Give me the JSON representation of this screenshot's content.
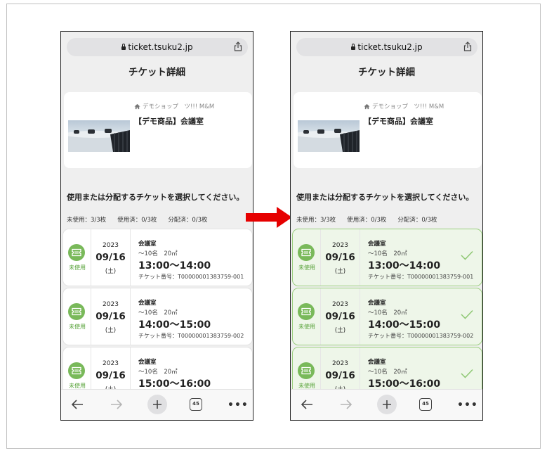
{
  "browser": {
    "url": "ticket.tsuku2.jp",
    "tab_count": "45"
  },
  "page": {
    "title": "チケット詳細",
    "shop": "デモショップ　ツ!!! M&M",
    "product_name": "【デモ商品】会議室",
    "select_heading": "使用または分配するチケットを選択してください。",
    "stats": {
      "unused": "未使用：3/3枚",
      "used": "使用済：0/3枚",
      "distributed": "分配済：0/3枚"
    }
  },
  "tickets": [
    {
      "status": "未使用",
      "year": "2023",
      "md": "09/16",
      "dow": "(土)",
      "room": "会議室",
      "capacity": "～10名　20㎡",
      "time": "13:00～14:00",
      "number": "チケット番号：T00000001383759-001"
    },
    {
      "status": "未使用",
      "year": "2023",
      "md": "09/16",
      "dow": "(土)",
      "room": "会議室",
      "capacity": "～10名　20㎡",
      "time": "14:00～15:00",
      "number": "チケット番号：T00000001383759-002"
    },
    {
      "status": "未使用",
      "year": "2023",
      "md": "09/16",
      "dow": "(土)",
      "room": "会議室",
      "capacity": "～10名　20㎡",
      "time": "15:00～16:00",
      "number": ""
    }
  ],
  "colors": {
    "accent_green": "#79b95a",
    "selected_border": "#9bcf7e",
    "selected_bg": "#eef6e9",
    "arrow": "#e60000"
  },
  "icons": [
    "lock-icon",
    "share-icon",
    "home-icon",
    "ticket-icon",
    "check-icon",
    "back-arrow-icon",
    "forward-arrow-icon",
    "plus-icon",
    "tabs-icon",
    "more-icon",
    "right-arrow-icon"
  ]
}
